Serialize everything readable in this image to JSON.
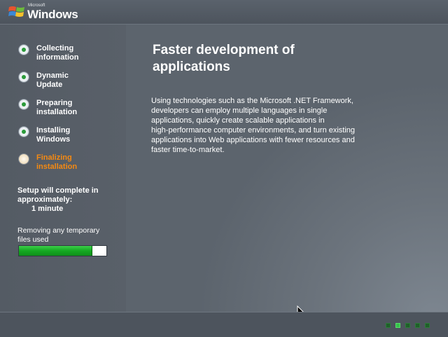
{
  "brand": {
    "microsoft": "Microsoft",
    "windows": "Windows"
  },
  "steps": [
    {
      "label": "Collecting\ninformation",
      "state": "done"
    },
    {
      "label": "Dynamic\nUpdate",
      "state": "done"
    },
    {
      "label": "Preparing\ninstallation",
      "state": "done"
    },
    {
      "label": "Installing\nWindows",
      "state": "done"
    },
    {
      "label": "Finalizing\ninstallation",
      "state": "current"
    }
  ],
  "eta": {
    "line1": "Setup will complete in approximately:",
    "time": "1 minute"
  },
  "status": {
    "text": "Removing any temporary\nfiles used",
    "progress_fraction": 0.84
  },
  "content": {
    "title": "Faster development of\napplications",
    "body": "Using technologies such as the Microsoft .NET Framework,\ndevelopers can employ multiple languages in single\napplications, quickly create scalable applications in\nhigh-performance computer environments, and turn existing\napplications into Web applications with fewer resources and\nfaster time-to-market."
  },
  "activity": {
    "count": 5,
    "active_index": 1
  },
  "colors": {
    "accent_current": "#f58a12",
    "done_dot": "#2a9a3a",
    "progress": "#15a822"
  }
}
